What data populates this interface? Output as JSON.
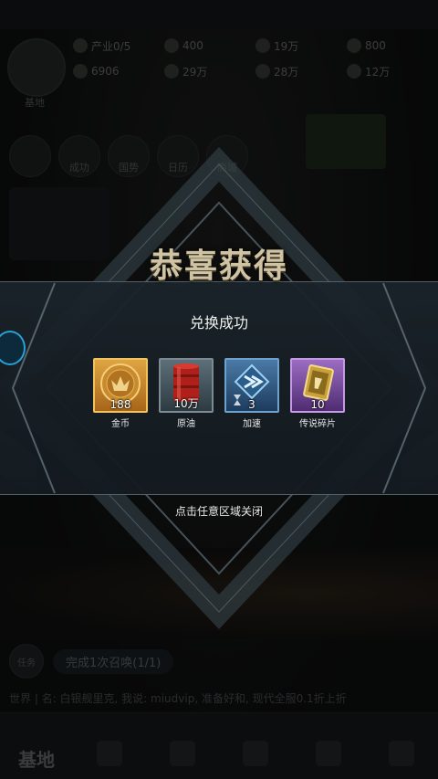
{
  "background": {
    "resources_row1": [
      "产业0/5",
      "400",
      "",
      "19万",
      "800"
    ],
    "resources_row2": [
      "6906",
      "29万",
      "28万",
      "12万"
    ],
    "avatar_label": "基地",
    "menu_buttons": [
      "",
      "成功",
      "国势",
      "日历",
      "商城"
    ],
    "task_icon_label": "任务",
    "task_text": "完成1次召唤(1/1)",
    "chat_line": "世界 | 名: 白银舰里克, 我说: miudvip, 准备好和, 现代全服0.1折上折",
    "bottom_nav": [
      "基地",
      "",
      "",
      "",
      "",
      ""
    ]
  },
  "reward_popup": {
    "title": "恭喜获得",
    "subtitle": "兑换成功",
    "close_hint": "点击任意区域关闭",
    "items": [
      {
        "count": "188",
        "name": "金币",
        "icon": "gold-coin-icon",
        "quality_color": "#f2c25e"
      },
      {
        "count": "10万",
        "name": "原油",
        "icon": "oil-barrel-icon",
        "quality_color": "#7c8b93"
      },
      {
        "count": "3",
        "name": "加速",
        "icon": "speedup-hourglass-icon",
        "quality_color": "#6da2cf"
      },
      {
        "count": "10",
        "name": "传说碎片",
        "icon": "legend-fragment-icon",
        "quality_color": "#c39ae3"
      }
    ]
  },
  "colors": {
    "title_text": "#cfc3a3",
    "band": "#1a242a"
  }
}
